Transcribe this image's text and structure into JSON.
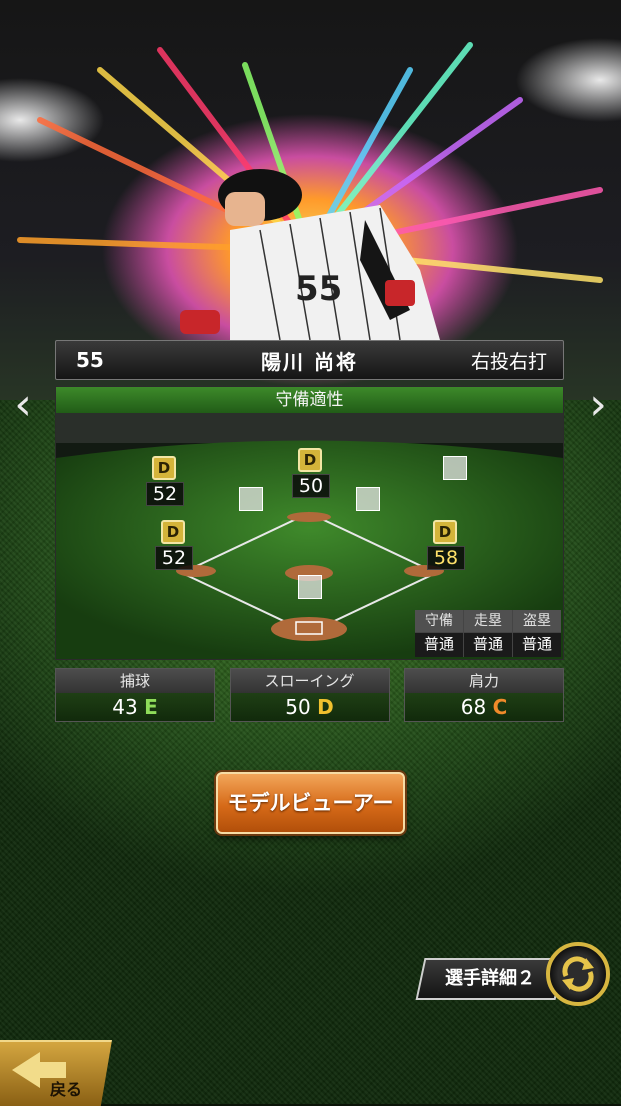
{
  "player": {
    "number": "55",
    "name": "陽川 尚将",
    "handedness": "右投右打"
  },
  "nav": {
    "prev_icon": "chevron-left-icon",
    "next_icon": "chevron-right-icon"
  },
  "defense": {
    "title": "守備適性",
    "positions": [
      {
        "id": "left",
        "grade": "D",
        "value": "52"
      },
      {
        "id": "center",
        "grade": "D",
        "value": "50"
      },
      {
        "id": "third",
        "grade": "D",
        "value": "52"
      },
      {
        "id": "first",
        "grade": "D",
        "value": "58"
      }
    ],
    "run_headers": [
      "守備",
      "走塁",
      "盗塁"
    ],
    "run_values": [
      "普通",
      "普通",
      "普通"
    ]
  },
  "stats": [
    {
      "label": "捕球",
      "value": "43",
      "grade": "E"
    },
    {
      "label": "スローイング",
      "value": "50",
      "grade": "D"
    },
    {
      "label": "肩力",
      "value": "68",
      "grade": "C"
    }
  ],
  "buttons": {
    "model_viewer": "モデルビューアー",
    "player_detail": "選手詳細２",
    "back": "戻る"
  },
  "colors": {
    "grade_E": "#8fdc5a",
    "grade_D": "#f0c12e",
    "grade_C": "#f08a2a",
    "accent_green": "#3d8a2a",
    "button_orange": "#d66a18"
  }
}
